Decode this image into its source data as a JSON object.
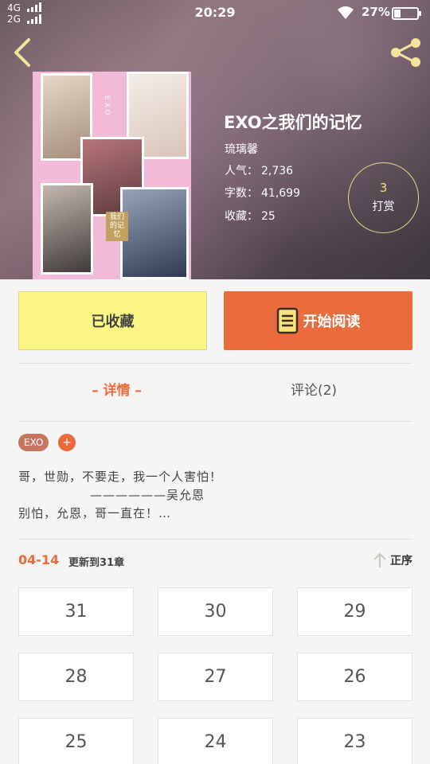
{
  "status_bar": {
    "network_top": "4G",
    "network_bottom": "2G",
    "time": "20:29",
    "battery_percent": "27%",
    "battery_level": 0.27
  },
  "nav": {
    "back_icon": "chevron-left-icon",
    "share_icon": "share-icon"
  },
  "book": {
    "title": "EXO之我们的记忆",
    "author": "琉璃馨",
    "popularity_label": "人气：",
    "popularity": "2,736",
    "word_count_label": "字数：",
    "word_count": "41,699",
    "favorites_label": "收藏：",
    "favorites": "25",
    "cover_exo_text": "EXO",
    "cover_tag_text": "我们的记忆"
  },
  "reward": {
    "count": "3",
    "label": "打赏"
  },
  "actions": {
    "collected_label": "已收藏",
    "read_label": "开始阅读",
    "collected_color": "#fbf583",
    "read_color": "#ea6b3c"
  },
  "tabs": {
    "detail": "– 详情 –",
    "comments": "评论(2)"
  },
  "tags": {
    "items": [
      "EXO"
    ],
    "add_label": "+"
  },
  "description": {
    "line1": "哥，世勋，不要走，我一个人害怕！",
    "line2": "——————吴允恩",
    "line3": "别怕，允恩，哥一直在！…"
  },
  "update": {
    "date": "04-14",
    "text": "更新到31章",
    "sort_label": "正序"
  },
  "chapters": [
    "31",
    "30",
    "29",
    "28",
    "27",
    "26",
    "25",
    "24",
    "23"
  ],
  "accent_color": "#ea6b3c"
}
